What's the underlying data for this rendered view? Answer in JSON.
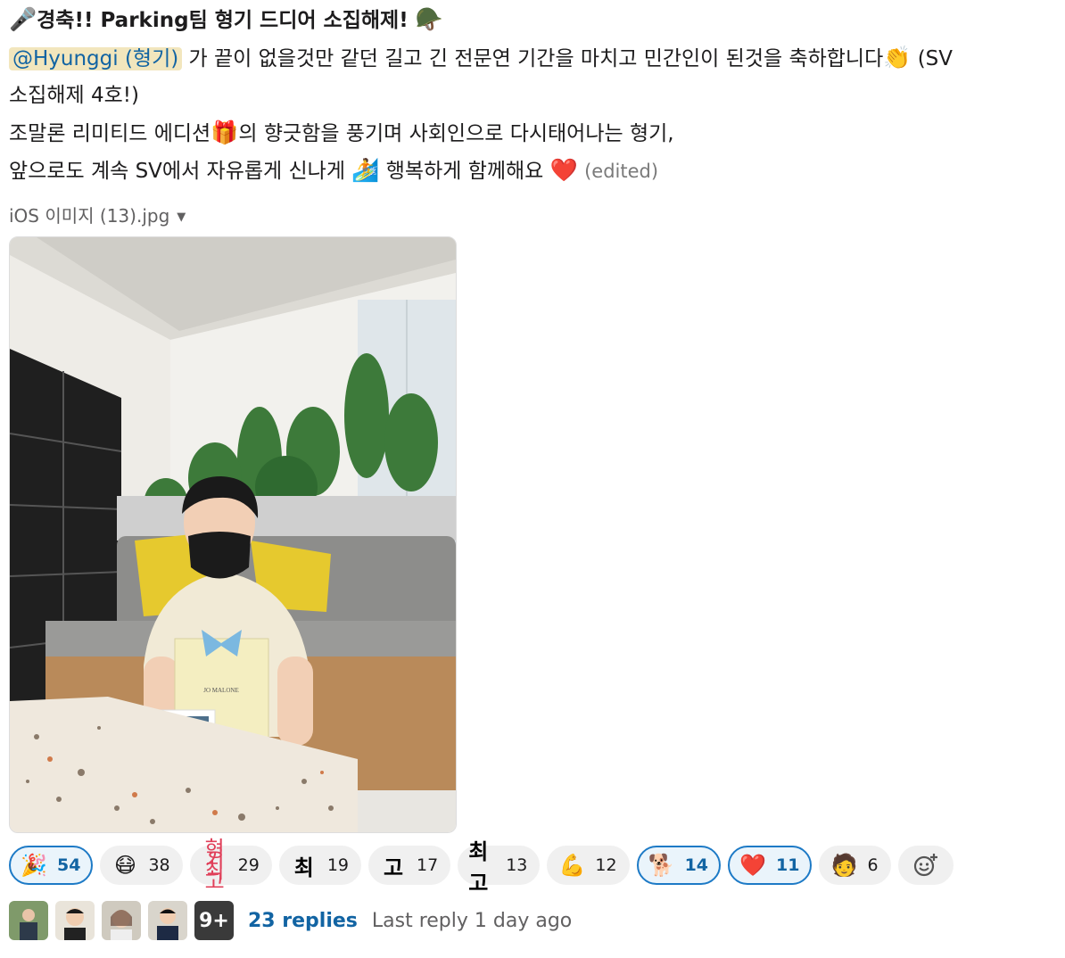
{
  "message": {
    "title_emoji_start": "🎤",
    "title": "경축!! Parking팀 형기 드디어 소집해제!",
    "title_emoji_end": "🪖",
    "mention": "@Hyunggi (형기)",
    "line1_rest": " 가 끝이 없을것만 같던 길고 긴 전문연 기간을 마치고 민간인이 된것을 축하합니다",
    "line1_emoji": "👏",
    "line1_tail": " (SV",
    "line2": "소집해제 4호!)",
    "line3_a": "조말론 리미티드 에디션",
    "line3_emoji": "🎁",
    "line3_b": "의 향긋함을 풍기며 사회인으로 다시태어나는 형기,",
    "line4_a": "앞으로도 계속 SV에서 자유롭게 신나게 ",
    "line4_emoji": "🏄",
    "line4_b": " 행복하게 함께해요 ",
    "line4_heart": "❤️",
    "edited": "(edited)"
  },
  "file": {
    "name": "iOS 이미지 (13).jpg",
    "caret": "▼"
  },
  "reactions": [
    {
      "emoji": "🎉",
      "count": "54",
      "mine": true
    },
    {
      "emoji": "😷",
      "count": "38",
      "mine": false
    },
    {
      "emoji_text": "형기 최고",
      "count": "29",
      "mine": false
    },
    {
      "emoji_text": "최",
      "count": "19",
      "mine": false
    },
    {
      "emoji_text": "고",
      "count": "17",
      "mine": false
    },
    {
      "emoji_text": "최고",
      "count": "13",
      "mine": false
    },
    {
      "emoji": "💪",
      "count": "12",
      "mine": false
    },
    {
      "emoji": "🐕",
      "count": "14",
      "mine": true
    },
    {
      "emoji": "❤️",
      "count": "11",
      "mine": true
    },
    {
      "emoji": "🧑",
      "count": "6",
      "mine": false
    }
  ],
  "add_reaction_icon": "😀+",
  "thread": {
    "more_avatars": "9+",
    "replies": "23 replies",
    "last_reply": "Last reply 1 day ago"
  }
}
